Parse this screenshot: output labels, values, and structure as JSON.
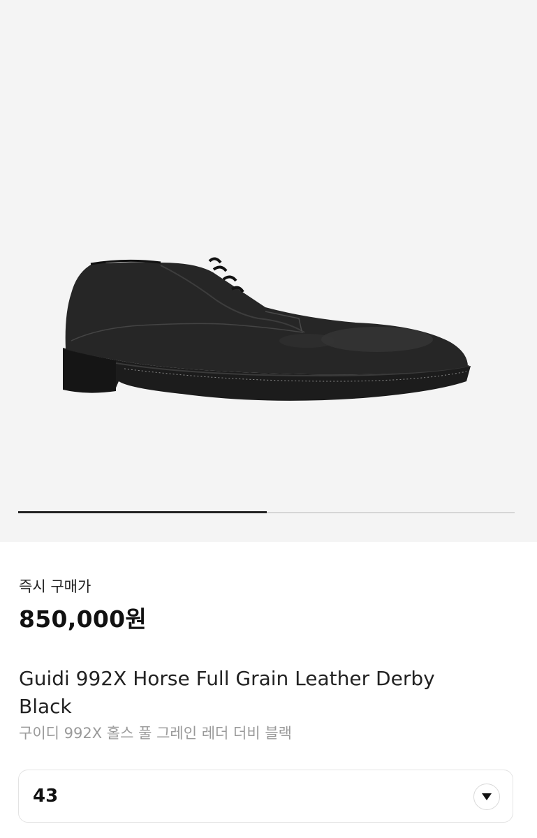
{
  "gallery": {
    "image_alt": "Guidi 992X black leather derby shoe",
    "progress_fraction": 0.5
  },
  "product": {
    "price_label": "즉시 구매가",
    "price": "850,000원",
    "title": "Guidi 992X Horse Full Grain Leather Derby Black",
    "title_ko": "구이디 992X 홀스 풀 그레인 레더 더비 블랙"
  },
  "size_select": {
    "value": "43",
    "icon": "chevron-down-icon"
  },
  "colors": {
    "background": "#ffffff",
    "gallery_bg": "#f4f4f4",
    "text_primary": "#222222",
    "text_secondary": "#9a9a9a",
    "progress_active": "#222222",
    "progress_track": "#d6d6d6"
  }
}
